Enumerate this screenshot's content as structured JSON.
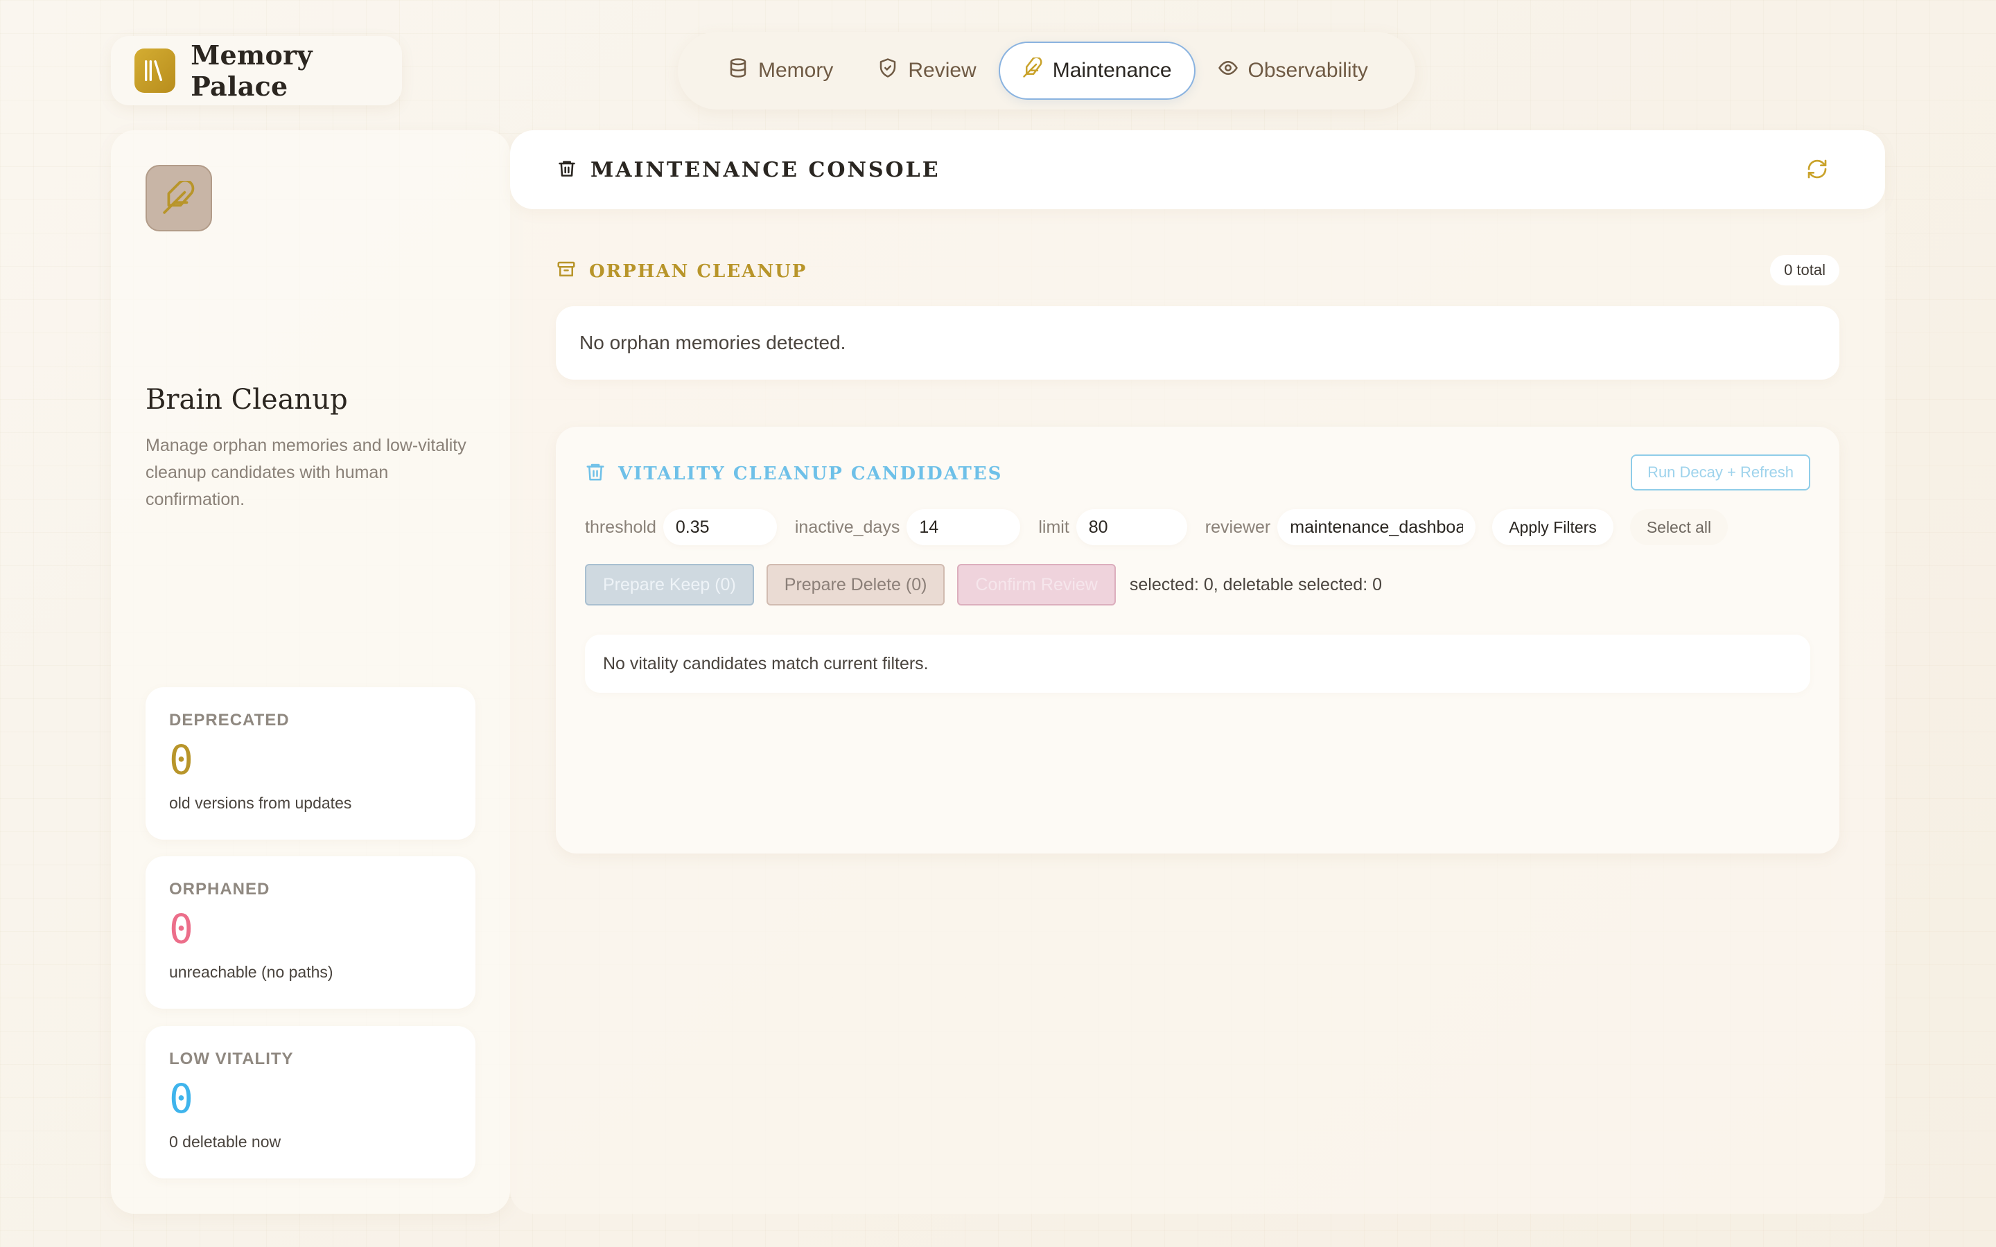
{
  "app": {
    "title": "Memory Palace",
    "accent": "#c9a22a"
  },
  "nav": {
    "items": [
      {
        "label": "Memory",
        "icon": "database-icon",
        "active": false
      },
      {
        "label": "Review",
        "icon": "shield-check-icon",
        "active": false
      },
      {
        "label": "Maintenance",
        "icon": "feather-icon",
        "active": true
      },
      {
        "label": "Observability",
        "icon": "eye-icon",
        "active": false
      }
    ]
  },
  "sidebar": {
    "icon": "feather-icon",
    "title": "Brain Cleanup",
    "description": "Manage orphan memories and low-vitality cleanup candidates with human confirmation.",
    "stats": [
      {
        "label": "DEPRECATED",
        "value": "0",
        "sub": "old versions from updates",
        "color": "#b8952a"
      },
      {
        "label": "ORPHANED",
        "value": "0",
        "sub": "unreachable (no paths)",
        "color": "#ec6e8a"
      },
      {
        "label": "LOW VITALITY",
        "value": "0",
        "sub": "0 deletable now",
        "color": "#3fb4ec"
      }
    ]
  },
  "console": {
    "title": "MAINTENANCE CONSOLE",
    "icon": "trash-icon",
    "refresh_icon": "refresh-icon"
  },
  "orphan": {
    "title": "ORPHAN CLEANUP",
    "icon": "archive-icon",
    "total": "0 total",
    "empty_message": "No orphan memories detected."
  },
  "vitality": {
    "title": "VITALITY CLEANUP CANDIDATES",
    "icon": "trash-icon",
    "run_decay_label": "Run Decay + Refresh",
    "filters": {
      "threshold_label": "threshold",
      "threshold_value": "0.35",
      "inactive_days_label": "inactive_days",
      "inactive_days_value": "14",
      "limit_label": "limit",
      "limit_value": "80",
      "reviewer_label": "reviewer",
      "reviewer_value": "maintenance_dashboard"
    },
    "apply_label": "Apply Filters",
    "select_all_label": "Select all",
    "prepare_keep_label": "Prepare Keep (0)",
    "prepare_delete_label": "Prepare Delete (0)",
    "confirm_review_label": "Confirm Review",
    "selection_status": "selected: 0, deletable selected: 0",
    "empty_message": "No vitality candidates match current filters."
  }
}
